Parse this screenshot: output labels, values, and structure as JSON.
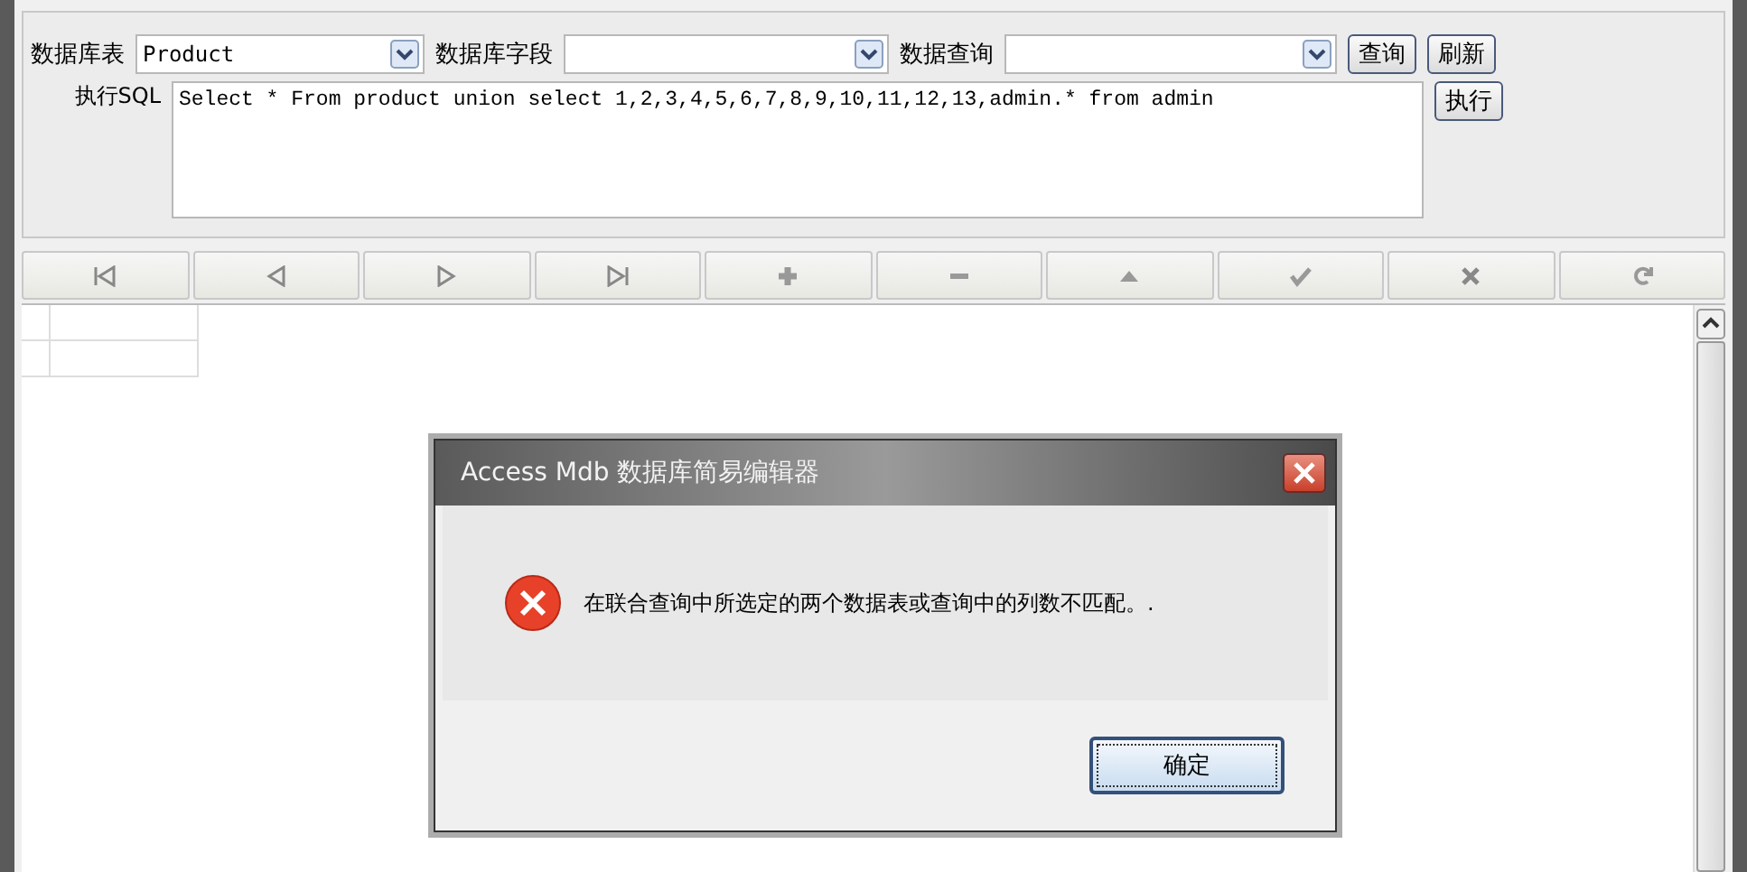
{
  "toolbar": {
    "table_label": "数据库表",
    "table_value": "Product",
    "field_label": "数据库字段",
    "query_label": "数据查询",
    "query_button": "查询",
    "refresh_button": "刷新"
  },
  "sql": {
    "label": "执行SQL",
    "value": "Select * From product union select 1,2,3,4,5,6,7,8,9,10,11,12,13,admin.* from admin",
    "run_button": "执行"
  },
  "navigator": [
    {
      "kind": "first"
    },
    {
      "kind": "prev"
    },
    {
      "kind": "next"
    },
    {
      "kind": "last"
    },
    {
      "kind": "add"
    },
    {
      "kind": "remove"
    },
    {
      "kind": "up"
    },
    {
      "kind": "confirm"
    },
    {
      "kind": "cancel"
    },
    {
      "kind": "refresh"
    }
  ],
  "dialog": {
    "title": "Access Mdb 数据库简易编辑器",
    "message": "在联合查询中所选定的两个数据表或查询中的列数不匹配。.",
    "ok_button": "确定"
  }
}
